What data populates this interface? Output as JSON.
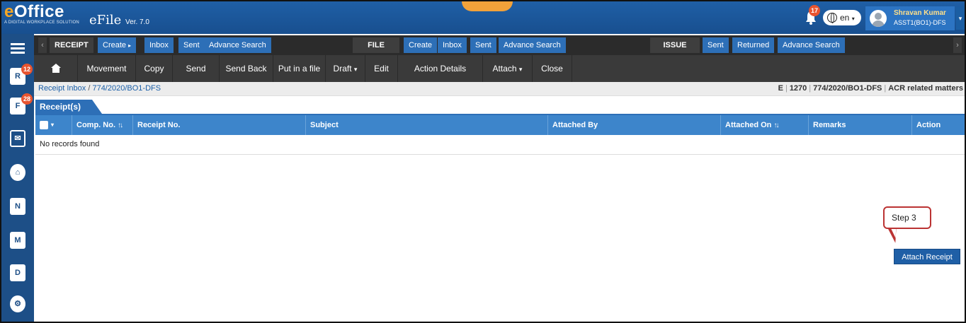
{
  "header": {
    "brand": "eOffice",
    "brand_tagline": "A DIGITAL WORKPLACE SOLUTION",
    "app_name": "eFile",
    "version": "Ver. 7.0",
    "notifications_count": "17",
    "language": "en",
    "user_name": "Shravan Kumar",
    "user_role": "ASST1(BO1)-DFS"
  },
  "sidebar": {
    "receipt_badge": "12",
    "file_badge": "28",
    "items": [
      "receipt-icon",
      "file-icon",
      "dak-icon",
      "home-icon",
      "new-mail-icon",
      "user-badge-icon",
      "documents-icon",
      "settings-user-icon"
    ]
  },
  "menubar": {
    "receipt_label": "RECEIPT",
    "receipt_create": "Create",
    "receipt_inbox": "Inbox",
    "receipt_sent": "Sent",
    "receipt_advance": "Advance Search",
    "file_label": "FILE",
    "file_create": "Create",
    "file_inbox": "Inbox",
    "file_sent": "Sent",
    "file_advance": "Advance Search",
    "issue_label": "ISSUE",
    "issue_sent": "Sent",
    "issue_returned": "Returned",
    "issue_advance": "Advance Search"
  },
  "toolbar": {
    "movement": "Movement",
    "copy": "Copy",
    "send": "Send",
    "send_back": "Send Back",
    "put_in_file": "Put in a file",
    "draft": "Draft",
    "edit": "Edit",
    "action_details": "Action Details",
    "attach": "Attach",
    "close": "Close"
  },
  "breadcrumb": {
    "root": "Receipt Inbox",
    "separator": "/",
    "current": "774/2020/BO1-DFS"
  },
  "meta": {
    "type": "E",
    "number": "1270",
    "receipt_no": "774/2020/BO1-DFS",
    "subject": "ACR related matters"
  },
  "tab": {
    "label": "Receipt(s)"
  },
  "table": {
    "columns": [
      "Comp. No.",
      "Receipt No.",
      "Subject",
      "Attached By",
      "Attached On",
      "Remarks",
      "Action"
    ],
    "sort_glyph": "↑↓",
    "empty_message": "No records found"
  },
  "callout": {
    "text": "Step 3"
  },
  "attach_receipt": {
    "label": "Attach Receipt"
  }
}
